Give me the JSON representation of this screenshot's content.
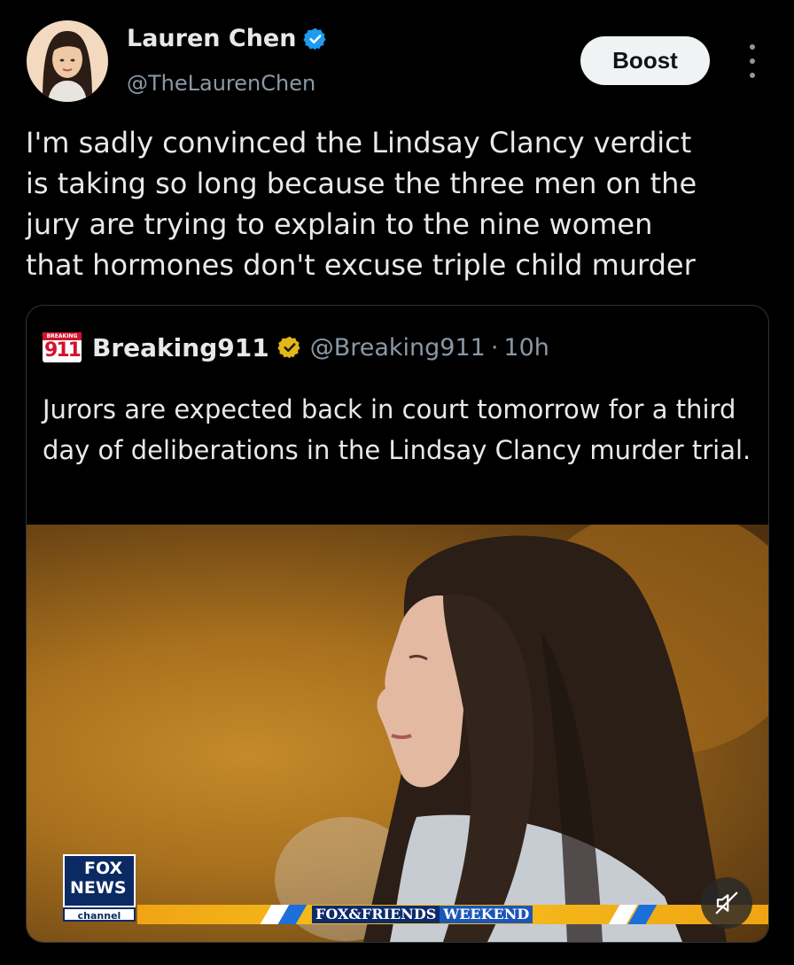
{
  "author": {
    "name": "Lauren Chen",
    "handle": "@TheLaurenChen",
    "verified_color": "#1d9bf0"
  },
  "actions": {
    "boost_label": "Boost",
    "more_icon": "more-vertical-icon"
  },
  "tweet": {
    "text": "I'm sadly convinced the Lindsay Clancy verdict\nis taking so long because the three men on the\njury are trying to explain to the nine women\nthat hormones don't excuse triple child murder"
  },
  "quote": {
    "logo_tag": "BREAKING",
    "logo_number": "911",
    "name": "Breaking911",
    "verified_color": "#e2b719",
    "handle": "@Breaking911",
    "separator": "·",
    "time": "10h",
    "text": "Jurors are expected back in court tomorrow for a third day of deliberations in the Lindsay Clancy murder trial.",
    "media": {
      "network_line1": "FOX",
      "network_line2": "NEWS",
      "network_channel": "channel",
      "show_main": "FOX&FRIENDS",
      "show_sub": "WEEKEND",
      "mute_icon": "volume-muted-icon"
    }
  },
  "colors": {
    "background": "#000000",
    "text_primary": "#e7e9ea",
    "text_secondary": "#8b98a5",
    "border": "#2f3336",
    "ticker_yellow": "#f0a414"
  }
}
